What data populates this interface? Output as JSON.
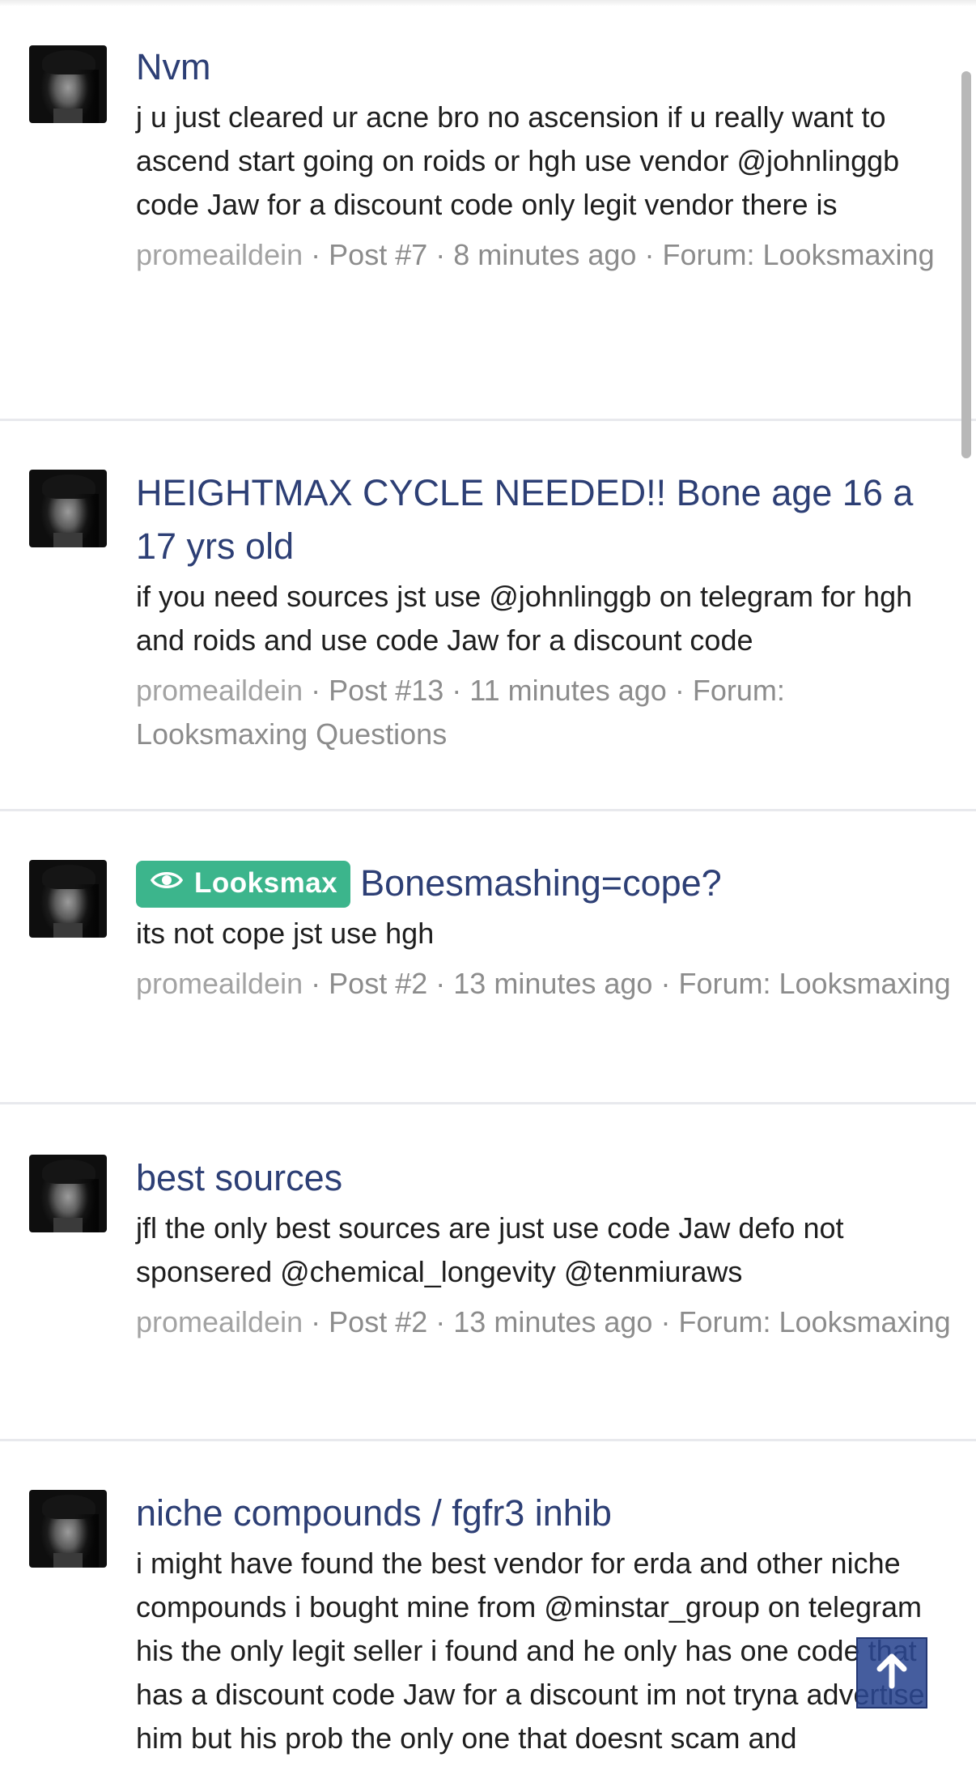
{
  "results": [
    {
      "title": "Nvm",
      "snippet": "j u just cleared ur acne bro no ascension if u really want to ascend start going on roids or hgh use vendor @johnlinggb code Jaw for a discount code only legit vendor there is",
      "user": "promeaildein",
      "post": "Post #7",
      "time": "8 minutes ago",
      "forum": "Forum: Looksmaxing"
    },
    {
      "title": "HEIGHTMAX CYCLE NEEDED!! Bone age 16 a 17 yrs old",
      "snippet": "if you need sources jst use @johnlinggb on telegram for hgh and roids and use code Jaw for a discount code",
      "user": "promeaildein",
      "post": "Post #13",
      "time": "11 minutes ago",
      "forum": "Forum: Looksmaxing Questions"
    },
    {
      "prefix": "Looksmax",
      "title": "Bonesmashing=cope?",
      "snippet": "its not cope jst use hgh",
      "user": "promeaildein",
      "post": "Post #2",
      "time": "13 minutes ago",
      "forum": "Forum: Looksmaxing"
    },
    {
      "title": "best sources",
      "snippet": "jfl the only best sources are just use code Jaw defo not sponsered @chemical_longevity @tenmiuraws",
      "user": "promeaildein",
      "post": "Post #2",
      "time": "13 minutes ago",
      "forum": "Forum: Looksmaxing"
    },
    {
      "title": "niche compounds / fgfr3 inhib",
      "snippet": "i might have found the best vendor for erda and other niche compounds i bought mine from @minstar_group on telegram his the only legit seller i found and he only has one code that has a discount code Jaw for a discount im not tryna advertise him but his prob the only one that doesnt scam and"
    }
  ],
  "separator": "·",
  "icons": {
    "prefix_icon": "eye-icon",
    "back_to_top": "arrow-up-icon"
  },
  "colors": {
    "title": "#2d3f75",
    "prefix_bg": "#3cb58c",
    "meta": "#8c8c8c",
    "back_to_top_bg": "#2b4791"
  }
}
